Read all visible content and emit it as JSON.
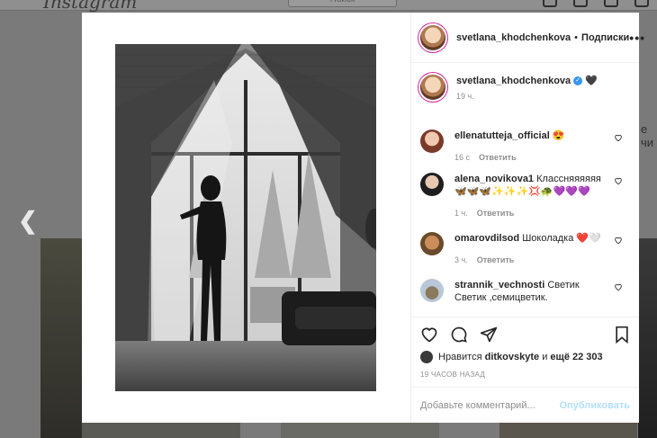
{
  "background": {
    "logo": "Instagram",
    "search_placeholder": "Поиск",
    "side_text": "е чи"
  },
  "post": {
    "author": "svetlana_khodchenkova",
    "follow_label": "Подписки",
    "dot": "•",
    "more": "•••",
    "caption_emoji": "🖤",
    "caption_time": "19 ч.",
    "reply_label": "Ответить"
  },
  "comments": [
    {
      "user": "ellenatutteja_official",
      "text": "😍",
      "time": "16 с"
    },
    {
      "user": "alena_novikova1",
      "text": "Классняяяяяя 🦋🦋🦋✨✨✨💢🐢💜💜💜",
      "time": "1 ч."
    },
    {
      "user": "omarovdilsod",
      "text": "Шоколадка ❤️🤍",
      "time": "3 ч."
    },
    {
      "user": "strannik_vechnosti",
      "text": "Светик Светик ,семицветик.",
      "time": ""
    }
  ],
  "likes": {
    "prefix": "Нравится",
    "user": "ditkovskyte",
    "joiner": "и",
    "rest": "ещё 22 303"
  },
  "posted_ago": "19 ЧАСОВ НАЗАД",
  "comment_box": {
    "placeholder": "Добавьте комментарий...",
    "publish_label": "Опубликовать"
  },
  "colors": {
    "link_blue": "#3897f0",
    "publish_disabled": "#b2dffc",
    "heart_red": "#ed4956"
  }
}
